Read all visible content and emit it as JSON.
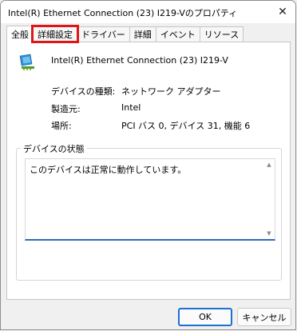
{
  "window": {
    "title": "Intel(R) Ethernet Connection (23) I219-Vのプロパティ",
    "close_glyph": "✕"
  },
  "tabs": [
    {
      "label": "全般",
      "active": true
    },
    {
      "label": "詳細設定",
      "highlighted": true
    },
    {
      "label": "ドライバー"
    },
    {
      "label": "詳細"
    },
    {
      "label": "イベント"
    },
    {
      "label": "リソース"
    }
  ],
  "device": {
    "icon": "network-adapter-icon",
    "name": "Intel(R) Ethernet Connection (23) I219-V",
    "properties": [
      {
        "label": "デバイスの種類:",
        "value": "ネットワーク アダプター"
      },
      {
        "label": "製造元:",
        "value": "Intel"
      },
      {
        "label": "場所:",
        "value": "PCI バス 0, デバイス 31, 機能 6"
      }
    ]
  },
  "status": {
    "group_title": "デバイスの状態",
    "text": "このデバイスは正常に動作しています。"
  },
  "buttons": {
    "ok": "OK",
    "cancel": "キャンセル"
  },
  "colors": {
    "highlight": "#e01515",
    "accent": "#2e6bb4"
  }
}
